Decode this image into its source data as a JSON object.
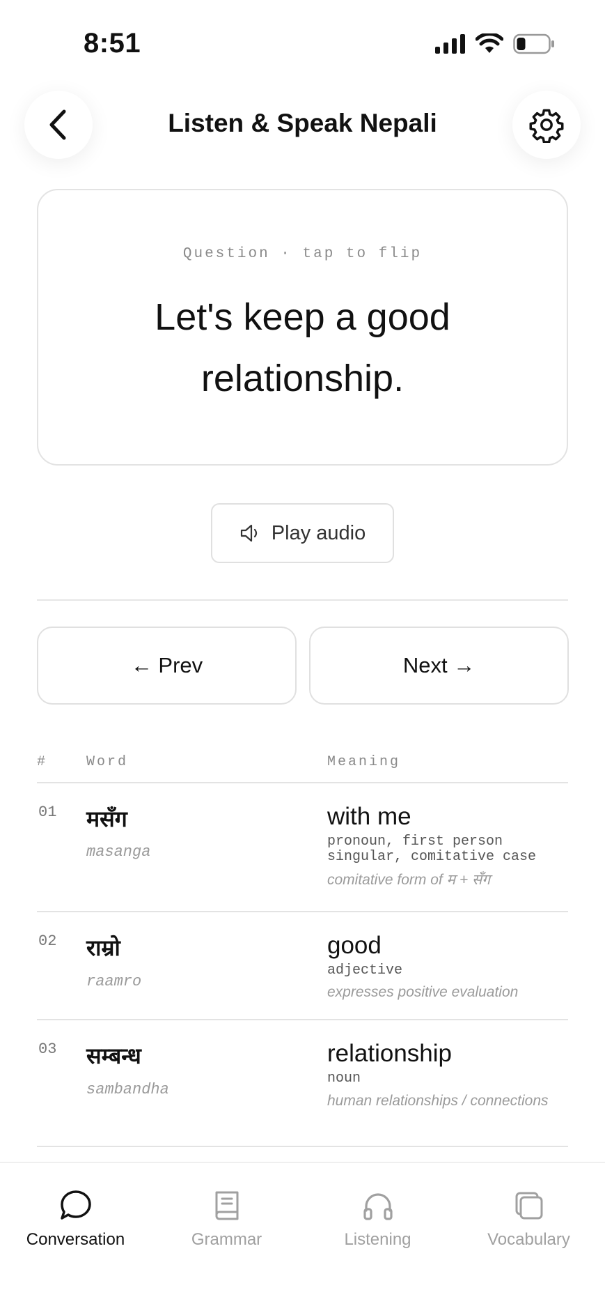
{
  "status_bar": {
    "time": "8:51"
  },
  "header": {
    "title": "Listen & Speak Nepali"
  },
  "card": {
    "hint": "Question · tap to flip",
    "text": "Let's keep a good relationship."
  },
  "audio": {
    "label": "Play audio"
  },
  "navigation": {
    "prev_label": "← Prev",
    "next_label": "Next →"
  },
  "table": {
    "headers": {
      "num": "#",
      "word": "Word",
      "meaning": "Meaning"
    },
    "rows": [
      {
        "num": "01",
        "word": "मसँग",
        "translit": "masanga",
        "meaning": "with me",
        "pos": "pronoun, first person singular, comitative case",
        "note": "comitative form of म + सँग"
      },
      {
        "num": "02",
        "word": "राम्रो",
        "translit": "raamro",
        "meaning": "good",
        "pos": "adjective",
        "note": "expresses positive evaluation"
      },
      {
        "num": "03",
        "word": "सम्बन्ध",
        "translit": "sambandha",
        "meaning": "relationship",
        "pos": "noun",
        "note": "human relationships / connections"
      }
    ]
  },
  "tabs": [
    {
      "label": "Conversation",
      "icon": "chat-bubble-icon",
      "active": true
    },
    {
      "label": "Grammar",
      "icon": "book-icon",
      "active": false
    },
    {
      "label": "Listening",
      "icon": "headphones-icon",
      "active": false
    },
    {
      "label": "Vocabulary",
      "icon": "cards-icon",
      "active": false
    }
  ],
  "colors": {
    "active_tab": "#111111",
    "inactive_tab": "#a0a0a0",
    "border": "#e3e3e3"
  }
}
